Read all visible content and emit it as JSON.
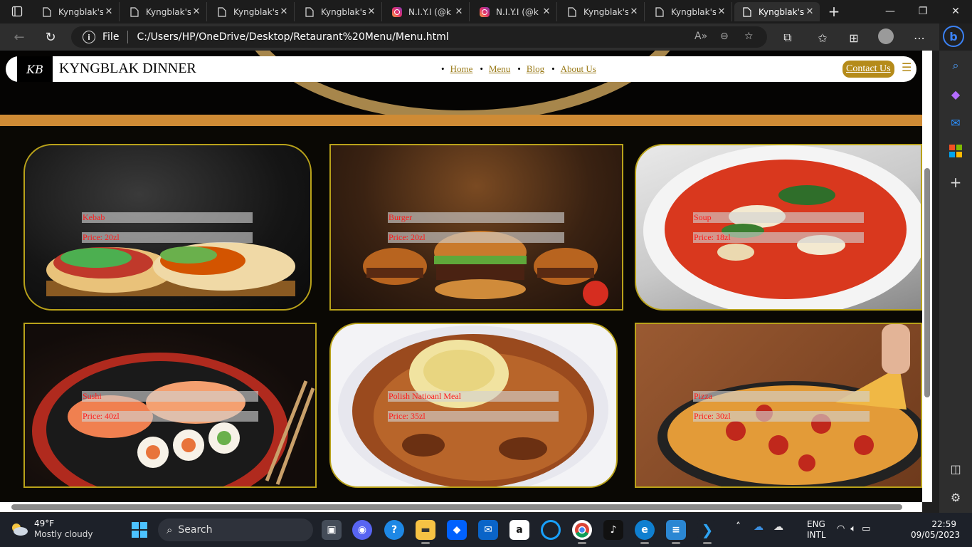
{
  "browser": {
    "tabs": [
      {
        "title": "Kyngblak's",
        "icon": "file-icon"
      },
      {
        "title": "Kyngblak's",
        "icon": "file-icon"
      },
      {
        "title": "Kyngblak's",
        "icon": "file-icon"
      },
      {
        "title": "Kyngblak's",
        "icon": "file-icon"
      },
      {
        "title": "N.I.Y.I (@k",
        "icon": "instagram-icon"
      },
      {
        "title": "N.I.Y.I (@k",
        "icon": "instagram-icon"
      },
      {
        "title": "Kyngblak's",
        "icon": "file-icon"
      },
      {
        "title": "Kyngblak's",
        "icon": "file-icon"
      },
      {
        "title": "Kyngblak's",
        "icon": "file-icon",
        "active": true
      }
    ],
    "address": {
      "scheme_label": "File",
      "url": "C:/Users/HP/OneDrive/Desktop/Retaurant%20Menu/Menu.html"
    }
  },
  "site": {
    "logo_text": "KB",
    "title": "KYNGBLAK DINNER",
    "nav": [
      "Home",
      "Menu",
      "Blog",
      "About Us"
    ],
    "contact_label": "Contact Us",
    "menu_icon": "hamburger-icon"
  },
  "menu_items": [
    {
      "name": "Kebab",
      "price": "Price: 20zl"
    },
    {
      "name": "Burger",
      "price": "Price: 20zl"
    },
    {
      "name": "Soup",
      "price": "Price: 18zl"
    },
    {
      "name": "Sushi",
      "price": "Price: 40zl"
    },
    {
      "name": "Polish Natioanl Meal",
      "price": "Price: 35zl"
    },
    {
      "name": "Pizza",
      "price": "Price: 30zl"
    }
  ],
  "taskbar": {
    "weather": {
      "temp": "49°F",
      "desc": "Mostly cloudy"
    },
    "search_label": "Search",
    "lang": {
      "line1": "ENG",
      "line2": "INTL"
    },
    "clock": {
      "time": "22:59",
      "date": "09/05/2023"
    }
  },
  "colors": {
    "accent_gold": "#b58b1a",
    "card_border": "#b9a21a",
    "price_text": "#ff1a1a",
    "band_orange": "#cf8b35"
  }
}
